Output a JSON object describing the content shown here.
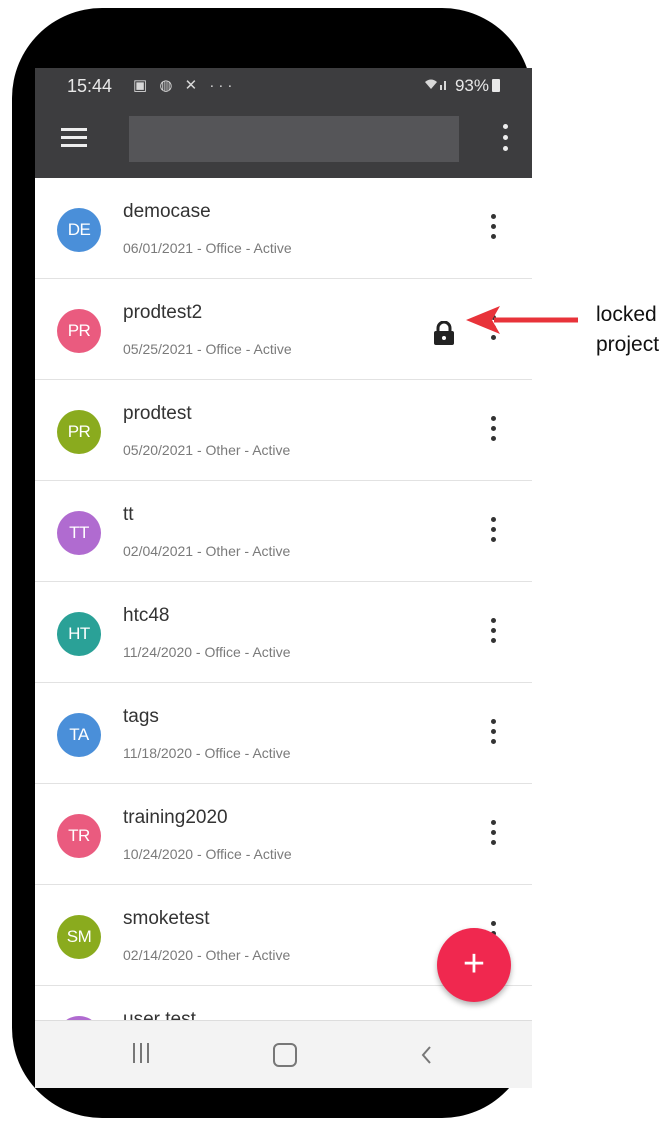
{
  "status_bar": {
    "time": "15:44",
    "icons_left": "▣ ◍ ✕ ···",
    "battery": "93%"
  },
  "app_bar": {
    "search_value": "",
    "menu_icon": "hamburger-icon",
    "more_icon": "kebab-menu-icon"
  },
  "projects": [
    {
      "initials": "DE",
      "name": "democase",
      "meta": "06/01/2021 - Office - Active",
      "color": "#4a8fd9",
      "locked": false
    },
    {
      "initials": "PR",
      "name": "prodtest2",
      "meta": "05/25/2021 - Office - Active",
      "color": "#ea5b7f",
      "locked": true
    },
    {
      "initials": "PR",
      "name": "prodtest",
      "meta": "05/20/2021 - Other - Active",
      "color": "#8aab1e",
      "locked": false
    },
    {
      "initials": "TT",
      "name": "tt",
      "meta": "02/04/2021 - Other - Active",
      "color": "#b06bd0",
      "locked": false
    },
    {
      "initials": "HT",
      "name": "htc48",
      "meta": "11/24/2020 - Office - Active",
      "color": "#2aa197",
      "locked": false
    },
    {
      "initials": "TA",
      "name": "tags",
      "meta": "11/18/2020 - Office - Active",
      "color": "#4a8fd9",
      "locked": false
    },
    {
      "initials": "TR",
      "name": "training2020",
      "meta": "10/24/2020 - Office - Active",
      "color": "#ea5b7f",
      "locked": false
    },
    {
      "initials": "SM",
      "name": "smoketest",
      "meta": "02/14/2020 - Other - Active",
      "color": "#8aab1e",
      "locked": false
    },
    {
      "initials": "",
      "name": "user test",
      "meta": "",
      "color": "#b06bd0",
      "locked": false
    }
  ],
  "fab": {
    "label": "+"
  },
  "annotation": {
    "line1": "locked",
    "line2": "project",
    "arrow_color": "#e8333a"
  }
}
